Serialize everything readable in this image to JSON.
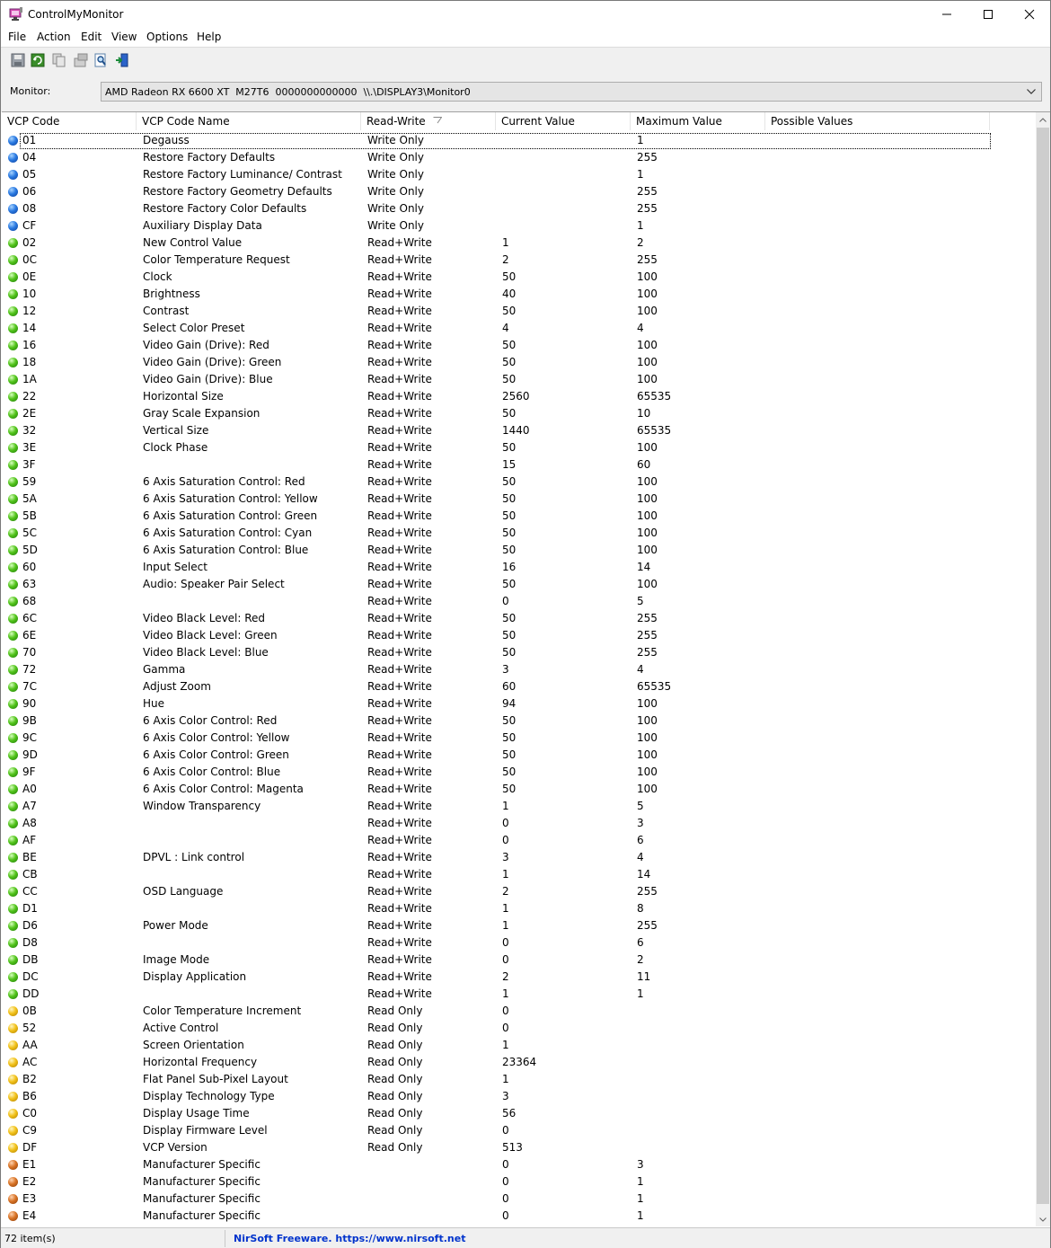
{
  "window": {
    "title": "ControlMyMonitor",
    "minimize_glyph": "—",
    "maximize_glyph": "☐",
    "close_glyph": "✕"
  },
  "menu": [
    "File",
    "Action",
    "Edit",
    "View",
    "Options",
    "Help"
  ],
  "toolbar": {
    "buttons": [
      "save-icon",
      "refresh-icon",
      "copy-icon",
      "properties-icon",
      "find-icon",
      "exit-icon"
    ]
  },
  "monitor": {
    "label": "Monitor:",
    "value": "AMD Radeon RX 6600 XT  M27T6  0000000000000  \\\\.\\DISPLAY3\\Monitor0"
  },
  "columns": [
    "VCP Code",
    "VCP Code Name",
    "Read-Write",
    "Current Value",
    "Maximum Value",
    "Possible Values"
  ],
  "rows": [
    {
      "dot": "blue",
      "code": "01",
      "name": "Degauss",
      "rw": "Write Only",
      "cur": "",
      "max": "1"
    },
    {
      "dot": "blue",
      "code": "04",
      "name": "Restore Factory Defaults",
      "rw": "Write Only",
      "cur": "",
      "max": "255"
    },
    {
      "dot": "blue",
      "code": "05",
      "name": "Restore Factory Luminance/ Contrast",
      "rw": "Write Only",
      "cur": "",
      "max": "1"
    },
    {
      "dot": "blue",
      "code": "06",
      "name": "Restore Factory Geometry Defaults",
      "rw": "Write Only",
      "cur": "",
      "max": "255"
    },
    {
      "dot": "blue",
      "code": "08",
      "name": "Restore Factory Color Defaults",
      "rw": "Write Only",
      "cur": "",
      "max": "255"
    },
    {
      "dot": "blue",
      "code": "CF",
      "name": "Auxiliary Display Data",
      "rw": "Write Only",
      "cur": "",
      "max": "1"
    },
    {
      "dot": "green",
      "code": "02",
      "name": "New Control Value",
      "rw": "Read+Write",
      "cur": "1",
      "max": "2"
    },
    {
      "dot": "green",
      "code": "0C",
      "name": "Color Temperature Request",
      "rw": "Read+Write",
      "cur": "2",
      "max": "255"
    },
    {
      "dot": "green",
      "code": "0E",
      "name": "Clock",
      "rw": "Read+Write",
      "cur": "50",
      "max": "100"
    },
    {
      "dot": "green",
      "code": "10",
      "name": "Brightness",
      "rw": "Read+Write",
      "cur": "40",
      "max": "100"
    },
    {
      "dot": "green",
      "code": "12",
      "name": "Contrast",
      "rw": "Read+Write",
      "cur": "50",
      "max": "100"
    },
    {
      "dot": "green",
      "code": "14",
      "name": "Select Color Preset",
      "rw": "Read+Write",
      "cur": "4",
      "max": "4"
    },
    {
      "dot": "green",
      "code": "16",
      "name": "Video Gain (Drive): Red",
      "rw": "Read+Write",
      "cur": "50",
      "max": "100"
    },
    {
      "dot": "green",
      "code": "18",
      "name": "Video Gain (Drive): Green",
      "rw": "Read+Write",
      "cur": "50",
      "max": "100"
    },
    {
      "dot": "green",
      "code": "1A",
      "name": "Video Gain (Drive): Blue",
      "rw": "Read+Write",
      "cur": "50",
      "max": "100"
    },
    {
      "dot": "green",
      "code": "22",
      "name": "Horizontal Size",
      "rw": "Read+Write",
      "cur": "2560",
      "max": "65535"
    },
    {
      "dot": "green",
      "code": "2E",
      "name": "Gray Scale Expansion",
      "rw": "Read+Write",
      "cur": "50",
      "max": "10"
    },
    {
      "dot": "green",
      "code": "32",
      "name": "Vertical Size",
      "rw": "Read+Write",
      "cur": "1440",
      "max": "65535"
    },
    {
      "dot": "green",
      "code": "3E",
      "name": "Clock Phase",
      "rw": "Read+Write",
      "cur": "50",
      "max": "100"
    },
    {
      "dot": "green",
      "code": "3F",
      "name": "",
      "rw": "Read+Write",
      "cur": "15",
      "max": "60"
    },
    {
      "dot": "green",
      "code": "59",
      "name": "6 Axis Saturation Control: Red",
      "rw": "Read+Write",
      "cur": "50",
      "max": "100"
    },
    {
      "dot": "green",
      "code": "5A",
      "name": "6 Axis Saturation Control: Yellow",
      "rw": "Read+Write",
      "cur": "50",
      "max": "100"
    },
    {
      "dot": "green",
      "code": "5B",
      "name": "6 Axis Saturation Control: Green",
      "rw": "Read+Write",
      "cur": "50",
      "max": "100"
    },
    {
      "dot": "green",
      "code": "5C",
      "name": "6 Axis Saturation Control: Cyan",
      "rw": "Read+Write",
      "cur": "50",
      "max": "100"
    },
    {
      "dot": "green",
      "code": "5D",
      "name": "6 Axis Saturation Control: Blue",
      "rw": "Read+Write",
      "cur": "50",
      "max": "100"
    },
    {
      "dot": "green",
      "code": "60",
      "name": "Input Select",
      "rw": "Read+Write",
      "cur": "16",
      "max": "14"
    },
    {
      "dot": "green",
      "code": "63",
      "name": "Audio: Speaker Pair Select",
      "rw": "Read+Write",
      "cur": "50",
      "max": "100"
    },
    {
      "dot": "green",
      "code": "68",
      "name": "",
      "rw": "Read+Write",
      "cur": "0",
      "max": "5"
    },
    {
      "dot": "green",
      "code": "6C",
      "name": "Video Black Level: Red",
      "rw": "Read+Write",
      "cur": "50",
      "max": "255"
    },
    {
      "dot": "green",
      "code": "6E",
      "name": "Video Black Level: Green",
      "rw": "Read+Write",
      "cur": "50",
      "max": "255"
    },
    {
      "dot": "green",
      "code": "70",
      "name": "Video Black Level: Blue",
      "rw": "Read+Write",
      "cur": "50",
      "max": "255"
    },
    {
      "dot": "green",
      "code": "72",
      "name": "Gamma",
      "rw": "Read+Write",
      "cur": "3",
      "max": "4"
    },
    {
      "dot": "green",
      "code": "7C",
      "name": "Adjust Zoom",
      "rw": "Read+Write",
      "cur": "60",
      "max": "65535"
    },
    {
      "dot": "green",
      "code": "90",
      "name": "Hue",
      "rw": "Read+Write",
      "cur": "94",
      "max": "100"
    },
    {
      "dot": "green",
      "code": "9B",
      "name": "6 Axis Color Control: Red",
      "rw": "Read+Write",
      "cur": "50",
      "max": "100"
    },
    {
      "dot": "green",
      "code": "9C",
      "name": "6 Axis Color Control: Yellow",
      "rw": "Read+Write",
      "cur": "50",
      "max": "100"
    },
    {
      "dot": "green",
      "code": "9D",
      "name": "6 Axis Color Control: Green",
      "rw": "Read+Write",
      "cur": "50",
      "max": "100"
    },
    {
      "dot": "green",
      "code": "9F",
      "name": "6 Axis Color Control: Blue",
      "rw": "Read+Write",
      "cur": "50",
      "max": "100"
    },
    {
      "dot": "green",
      "code": "A0",
      "name": "6 Axis Color Control: Magenta",
      "rw": "Read+Write",
      "cur": "50",
      "max": "100"
    },
    {
      "dot": "green",
      "code": "A7",
      "name": "Window Transparency",
      "rw": "Read+Write",
      "cur": "1",
      "max": "5"
    },
    {
      "dot": "green",
      "code": "A8",
      "name": "",
      "rw": "Read+Write",
      "cur": "0",
      "max": "3"
    },
    {
      "dot": "green",
      "code": "AF",
      "name": "",
      "rw": "Read+Write",
      "cur": "0",
      "max": "6"
    },
    {
      "dot": "green",
      "code": "BE",
      "name": "DPVL : Link control",
      "rw": "Read+Write",
      "cur": "3",
      "max": "4"
    },
    {
      "dot": "green",
      "code": "CB",
      "name": "",
      "rw": "Read+Write",
      "cur": "1",
      "max": "14"
    },
    {
      "dot": "green",
      "code": "CC",
      "name": "OSD Language",
      "rw": "Read+Write",
      "cur": "2",
      "max": "255"
    },
    {
      "dot": "green",
      "code": "D1",
      "name": "",
      "rw": "Read+Write",
      "cur": "1",
      "max": "8"
    },
    {
      "dot": "green",
      "code": "D6",
      "name": "Power Mode",
      "rw": "Read+Write",
      "cur": "1",
      "max": "255"
    },
    {
      "dot": "green",
      "code": "D8",
      "name": "",
      "rw": "Read+Write",
      "cur": "0",
      "max": "6"
    },
    {
      "dot": "green",
      "code": "DB",
      "name": "Image Mode",
      "rw": "Read+Write",
      "cur": "0",
      "max": "2"
    },
    {
      "dot": "green",
      "code": "DC",
      "name": "Display Application",
      "rw": "Read+Write",
      "cur": "2",
      "max": "11"
    },
    {
      "dot": "green",
      "code": "DD",
      "name": "",
      "rw": "Read+Write",
      "cur": "1",
      "max": "1"
    },
    {
      "dot": "yellow",
      "code": "0B",
      "name": "Color Temperature Increment",
      "rw": "Read Only",
      "cur": "0",
      "max": ""
    },
    {
      "dot": "yellow",
      "code": "52",
      "name": "Active Control",
      "rw": "Read Only",
      "cur": "0",
      "max": ""
    },
    {
      "dot": "yellow",
      "code": "AA",
      "name": "Screen Orientation",
      "rw": "Read Only",
      "cur": "1",
      "max": ""
    },
    {
      "dot": "yellow",
      "code": "AC",
      "name": "Horizontal Frequency",
      "rw": "Read Only",
      "cur": "23364",
      "max": ""
    },
    {
      "dot": "yellow",
      "code": "B2",
      "name": "Flat Panel Sub-Pixel Layout",
      "rw": "Read Only",
      "cur": "1",
      "max": ""
    },
    {
      "dot": "yellow",
      "code": "B6",
      "name": "Display Technology Type",
      "rw": "Read Only",
      "cur": "3",
      "max": ""
    },
    {
      "dot": "yellow",
      "code": "C0",
      "name": "Display Usage Time",
      "rw": "Read Only",
      "cur": "56",
      "max": ""
    },
    {
      "dot": "yellow",
      "code": "C9",
      "name": "Display Firmware Level",
      "rw": "Read Only",
      "cur": "0",
      "max": ""
    },
    {
      "dot": "yellow",
      "code": "DF",
      "name": "VCP Version",
      "rw": "Read Only",
      "cur": "513",
      "max": ""
    },
    {
      "dot": "orange",
      "code": "E1",
      "name": "Manufacturer Specific",
      "rw": "",
      "cur": "0",
      "max": "3"
    },
    {
      "dot": "orange",
      "code": "E2",
      "name": "Manufacturer Specific",
      "rw": "",
      "cur": "0",
      "max": "1"
    },
    {
      "dot": "orange",
      "code": "E3",
      "name": "Manufacturer Specific",
      "rw": "",
      "cur": "0",
      "max": "1"
    },
    {
      "dot": "orange",
      "code": "E4",
      "name": "Manufacturer Specific",
      "rw": "",
      "cur": "0",
      "max": "1"
    }
  ],
  "status": {
    "count": "72 item(s)",
    "link": "NirSoft Freeware. https://www.nirsoft.net"
  },
  "colors": {
    "status_link": "#0033cc",
    "write_only_dot": "#2a7ae2",
    "read_write_dot": "#52c41a",
    "read_only_dot": "#f2c21a",
    "manufacturer_dot": "#d97426"
  }
}
